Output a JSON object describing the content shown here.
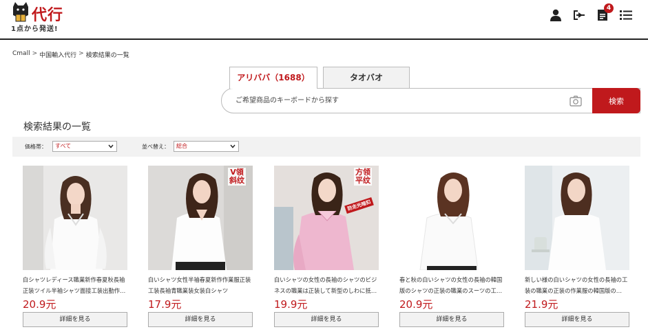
{
  "header": {
    "logo_text": "代行",
    "logo_sub": "1点から発送!",
    "cart_badge": "4",
    "icons": [
      "user-icon",
      "logout-icon",
      "order-icon",
      "menu-icon"
    ]
  },
  "breadcrumb": [
    "Cmall",
    "中国輸入代行",
    "検索結果の一覧"
  ],
  "breadcrumb_sep": ">",
  "tabs": [
    {
      "label": "アリババ（1688）",
      "active": true
    },
    {
      "label": "タオバオ",
      "active": false
    }
  ],
  "search": {
    "placeholder": "ご希望商品のキーボードから探す",
    "value": "",
    "button": "検索"
  },
  "results_title": "検索結果の一覧",
  "filters": {
    "price_label": "価格帯：",
    "price_value": "すべて",
    "sort_label": "並べ替え：",
    "sort_value": "総合"
  },
  "products": [
    {
      "title": "白シャツレディース職業新作春夏秋長袖正装ツイル半袖シャツ面接工装出勤作…",
      "price": "20.9元",
      "button": "詳細を見る",
      "tags": []
    },
    {
      "title": "白いシャツ女性半袖春夏新作作業服正装工装長袖青職業装女装白シャツ",
      "price": "17.9元",
      "button": "詳細を見る",
      "tags": [
        "V領",
        "斜纹"
      ]
    },
    {
      "title": "白いシャツの女性の長袖のシャツのビジネスの職業は正装して新型のしわに抵抗し…",
      "price": "19.9元",
      "button": "詳細を見る",
      "tags": [
        "方领",
        "平纹"
      ],
      "ribbon": "防走光暗扣"
    },
    {
      "title": "春と秋の白いシャツの女性の長袖の韓国版のシャツの正装の職業のスーツの工装…",
      "price": "20.9元",
      "button": "詳細を見る",
      "tags": []
    },
    {
      "title": "新しい様の白いシャツの女性の長袖の工装の職業の正装の作業服の韓国版の…",
      "price": "21.9元",
      "button": "詳細を見る",
      "tags": []
    }
  ],
  "colors": {
    "accent": "#c0191c",
    "filter_bg": "#f2f2f2",
    "shirt_pink": "#eeb7cf"
  }
}
